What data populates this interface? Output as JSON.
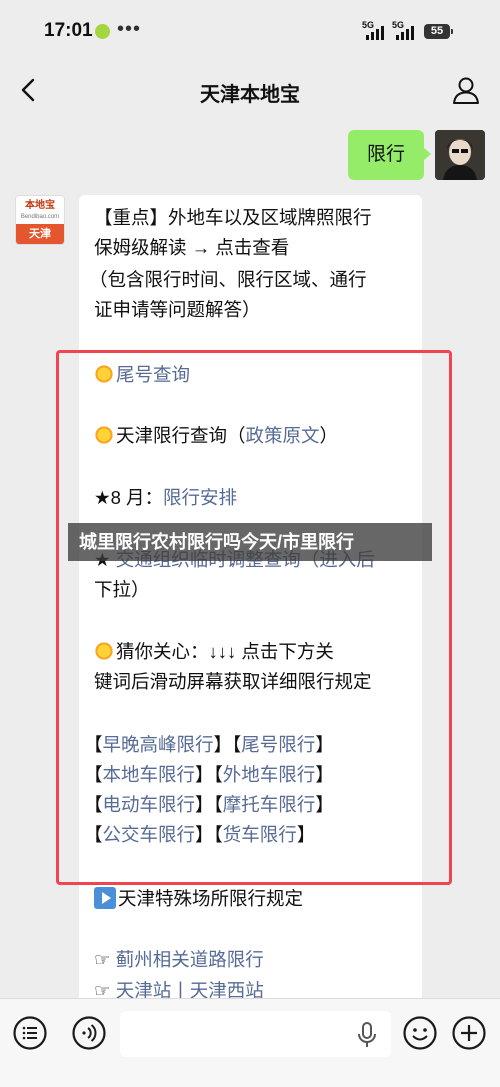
{
  "status_bar": {
    "time": "17:01",
    "more": "•••",
    "signal_1": "5G",
    "signal_2": "5G",
    "battery": "55"
  },
  "nav": {
    "title": "天津本地宝",
    "back_icon": "chevron-left-icon",
    "profile_icon": "person-icon"
  },
  "messages": {
    "outgoing": {
      "text": "限行"
    },
    "incoming": {
      "avatar_top": "本地宝",
      "avatar_site": "Bendibao.com",
      "avatar_bottom": "天津",
      "lines": {
        "l1": "【重点】外地车以及区域牌照限行",
        "l2": "保姆级解读 → 点击查看",
        "l3": "（包含限行时间、限行区域、通行",
        "l4": "证申请等问题解答）",
        "l5": "尾号查询",
        "l6a": "天津限行查询（",
        "l6b": "政策原文",
        "l6c": "）",
        "l7a": "★8 月：",
        "l7b": "限行安排",
        "l8a": "★ ",
        "l8b": "交通组织临时调整查询（进入后",
        "l9": "下拉）",
        "l10": "猜你关心：↓↓↓ 点击下方关",
        "l11": "键词后滑动屏幕获取详细限行规定",
        "tags": [
          [
            "早晚高峰限行",
            "尾号限行"
          ],
          [
            "本地车限行",
            "外地车限行"
          ],
          [
            "电动车限行",
            "摩托车限行"
          ],
          [
            "公交车限行",
            "货车限行"
          ]
        ],
        "l16": "天津特殊场所限行规定",
        "l17a": "☞ ",
        "l17b": "蓟州相关道路限行",
        "l18a": "☞ ",
        "l18b": "天津站丨天津西站"
      }
    }
  },
  "overlay_banner": "城里限行农村限行吗今天/市里限行",
  "input_bar": {
    "list_icon": "list-icon",
    "voice_icon": "voice-mode-icon",
    "mic_icon": "microphone-icon",
    "emoji_icon": "emoji-icon",
    "plus_icon": "plus-icon"
  }
}
